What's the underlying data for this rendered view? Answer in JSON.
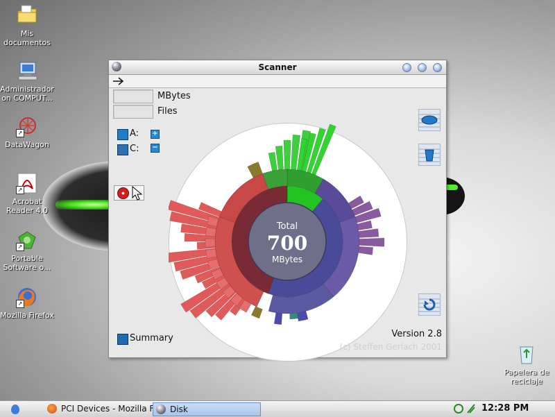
{
  "desktop": {
    "icons": [
      {
        "label": "Mis documentos"
      },
      {
        "label": "Administrador on COMPUT..."
      },
      {
        "label": "DataWagon"
      },
      {
        "label": "Acrobat Reader 4.0"
      },
      {
        "label": "Portable Software o..."
      },
      {
        "label": "Mozilla Firefox"
      },
      {
        "label": "Papelera de reciclaje"
      }
    ]
  },
  "window": {
    "title": "Scanner",
    "stats": {
      "mbytes_label": "MBytes",
      "files_label": "Files"
    },
    "drives": [
      {
        "label": "A:"
      },
      {
        "label": "C:"
      }
    ],
    "center": {
      "top": "Total",
      "value": "700",
      "unit": "MBytes"
    },
    "version": "Version 2.8",
    "copyright": "(c) Steffen Gerlach 2001",
    "summary_label": "Summary"
  },
  "colors": {
    "red": "#e05a5a",
    "green": "#22c422",
    "blue": "#4a4a9a",
    "purple": "#8a5aa0",
    "center": "#6f6f8a"
  },
  "taskbar": {
    "tasks": [
      {
        "label": "PCI Devices - Mozilla Fi...",
        "active": false
      },
      {
        "label": "Disk",
        "active": true
      }
    ],
    "clock": "12:28 PM"
  }
}
